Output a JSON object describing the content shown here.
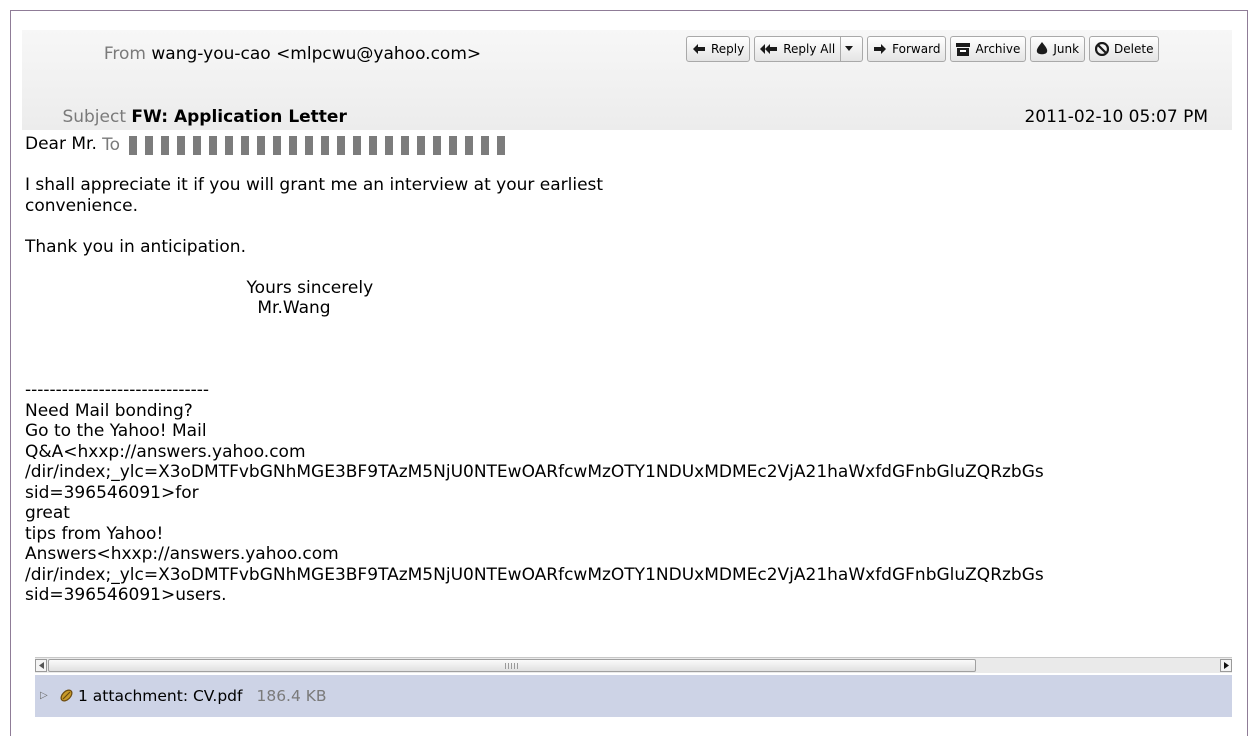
{
  "header": {
    "from_label": "From",
    "from_value": "wang-you-cao <mlpcwu@yahoo.com>",
    "subject_label": "Subject",
    "subject_value": "FW: Application Letter",
    "to_label": "To",
    "date": "2011-02-10 05:07 PM"
  },
  "toolbar": {
    "reply": "Reply",
    "reply_all": "Reply All",
    "forward": "Forward",
    "archive": "Archive",
    "junk": "Junk",
    "delete": "Delete"
  },
  "body_text": "Dear Mr.\n\nI shall appreciate it if you will grant me an interview at your earliest\nconvenience.\n\nThank you in anticipation.\n\n                                         Yours sincerely\n                                           Mr.Wang\n\n\n\n------------------------------\nNeed Mail bonding?\nGo to the Yahoo! Mail\nQ&A<hxxp://answers.yahoo.com\n/dir/index;_ylc=X3oDMTFvbGNhMGE3BF9TAzM5NjU0NTEwOARfcwMzOTY1NDUxMDMEc2VjA21haWxfdGFnbGluZQRzbGs\nsid=396546091>for\ngreat\ntips from Yahoo!\nAnswers<hxxp://answers.yahoo.com\n/dir/index;_ylc=X3oDMTFvbGNhMGE3BF9TAzM5NjU0NTEwOARfcwMzOTY1NDUxMDMEc2VjA21haWxfdGFnbGluZQRzbGs\nsid=396546091>users.",
  "attachment": {
    "label": "1 attachment: CV.pdf",
    "size": "186.4 KB"
  },
  "icons": {
    "reply": "reply-icon",
    "reply_all": "reply-all-icon",
    "forward": "forward-icon",
    "archive": "archive-icon",
    "junk": "junk-icon",
    "delete": "delete-icon",
    "attachment": "paperclip-icon"
  }
}
